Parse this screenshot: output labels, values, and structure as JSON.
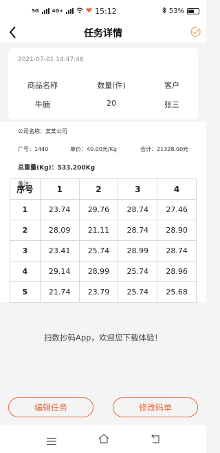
{
  "status_bar": {
    "signal_1": "5G",
    "signal_2": "4G+",
    "time": "15:12",
    "battery_percent": "53%"
  },
  "nav": {
    "title": "任务详情"
  },
  "summary": {
    "timestamp": "2021-07-01 14:47:46",
    "headers": [
      "商品名称",
      "数量(件)",
      "客户"
    ],
    "values": [
      "牛腩",
      "20",
      "张三"
    ]
  },
  "info": {
    "company_label": "公司名称：",
    "company_value": "某某公司",
    "factory_label": "厂号：",
    "factory_value": "1440",
    "unit_price_label": "单价：",
    "unit_price_value": "40.00元/Kg",
    "total_label": "合计：",
    "total_value": "21328.00元",
    "gross_weight_label": "总重量(Kg)：",
    "gross_weight_value": "533.200Kg",
    "remark_label": "备注："
  },
  "table": {
    "headers": [
      "序号",
      "1",
      "2",
      "3",
      "4"
    ],
    "rows": [
      [
        "1",
        "23.74",
        "29.76",
        "28.74",
        "27.46"
      ],
      [
        "2",
        "28.09",
        "21.11",
        "28.74",
        "28.90"
      ],
      [
        "3",
        "23.41",
        "25.74",
        "28.99",
        "28.74"
      ],
      [
        "4",
        "29.14",
        "28.99",
        "25.74",
        "28.96"
      ],
      [
        "5",
        "21.74",
        "23.79",
        "25.74",
        "25.68"
      ]
    ]
  },
  "footer_message": "扫数抄码App，欢迎您下载体验！",
  "buttons": {
    "edit_label": "编辑任务",
    "modify_label": "修改码单"
  },
  "colors": {
    "accent": "#e8673a",
    "check_icon": "#f0a860"
  }
}
